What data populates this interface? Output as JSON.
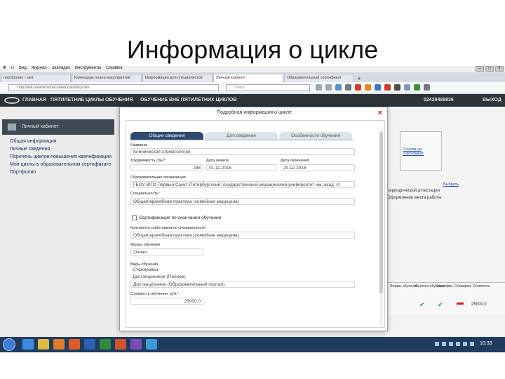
{
  "slide": {
    "title": "Информация  о цикле"
  },
  "browser": {
    "menu": [
      "Ф",
      "П",
      "Вид",
      "Журнал",
      "Закладки",
      "Инструменты",
      "Справка"
    ],
    "tabs": [
      "портфолио - sert",
      "Календарь плана мероприятий",
      "Информация для специалистов",
      "Личный кабинет",
      "Образовательный сертификат"
    ],
    "url": "http://edu.rosminzdrav.ru/education/cycles",
    "search_placeholder": "Поиск"
  },
  "site": {
    "nav": [
      "ГЛАВНАЯ",
      "ПЯТИЛЕТНИЕ ЦИКЛЫ ОБУЧЕНИЯ",
      "ОБУЧЕНИЕ ВНЕ ПЯТИЛЕТНИХ ЦИКЛОВ"
    ],
    "phone": "02429489836",
    "logout": "ВЫХОД"
  },
  "sidebar": {
    "cabinet_label": "Личный кабинет",
    "items": [
      "Общая информация",
      "Личные сведения",
      "Перечень циклов повышения квалификации",
      "Мои циклы в образовательном сертификате",
      "Портфолио"
    ]
  },
  "modal": {
    "title": "Подробная информация о цикле",
    "tabs": [
      "Общие сведения",
      "Доп.сведения",
      "Особенности обучения"
    ],
    "fields": {
      "name_label": "Название",
      "name_value": "Клиническая стоматология",
      "hours_label": "Трудоемкость (ЗЕ)*",
      "hours_value": "288",
      "start_label": "Дата начала",
      "start_value": "01.11.2016",
      "end_label": "Дата окончания",
      "end_value": "20.12.2016",
      "org_label": "Образовательная организация",
      "org_value": "ГБОУ ВПО Первый Санкт-Петербургский государственный медицинский университет им. акад. И.",
      "spec_label": "Специальность*",
      "spec_value": "Общая врачебная практика (семейная медицина)",
      "cert_label": "Сертификация по окончании обучения",
      "contingent_label": "Контингент работников по специальности",
      "contingent_value": "Общая врачебная практика (семейная медицина)",
      "form_label": "Форма обучения",
      "form_value": "Очная",
      "features_label": "Виды обучения",
      "features_values": [
        "Стажировка",
        "Дистанционное (Полное)",
        "Дистанционное (Образовательный портал)"
      ],
      "cost_label": "Стоимость обучения, руб.*",
      "cost_value": "25000.0"
    }
  },
  "background_page": {
    "link1": "Ссылка на сертификат",
    "link2": "Выбрать",
    "text1": "периодической аттестации",
    "text2": "Оформление места работы",
    "table_headers": [
      "Формы обучения",
      "Ступень обучения",
      "Сертифик",
      "Стажиров",
      "Стоимость"
    ],
    "table_value": "25000.0"
  },
  "taskbar": {
    "clock": "10:33"
  },
  "colors": {
    "header_dark": "#2e3338",
    "tab_active": "#2f4a70",
    "close_red": "#c21e1e",
    "check_green": "#2e8b2e"
  }
}
